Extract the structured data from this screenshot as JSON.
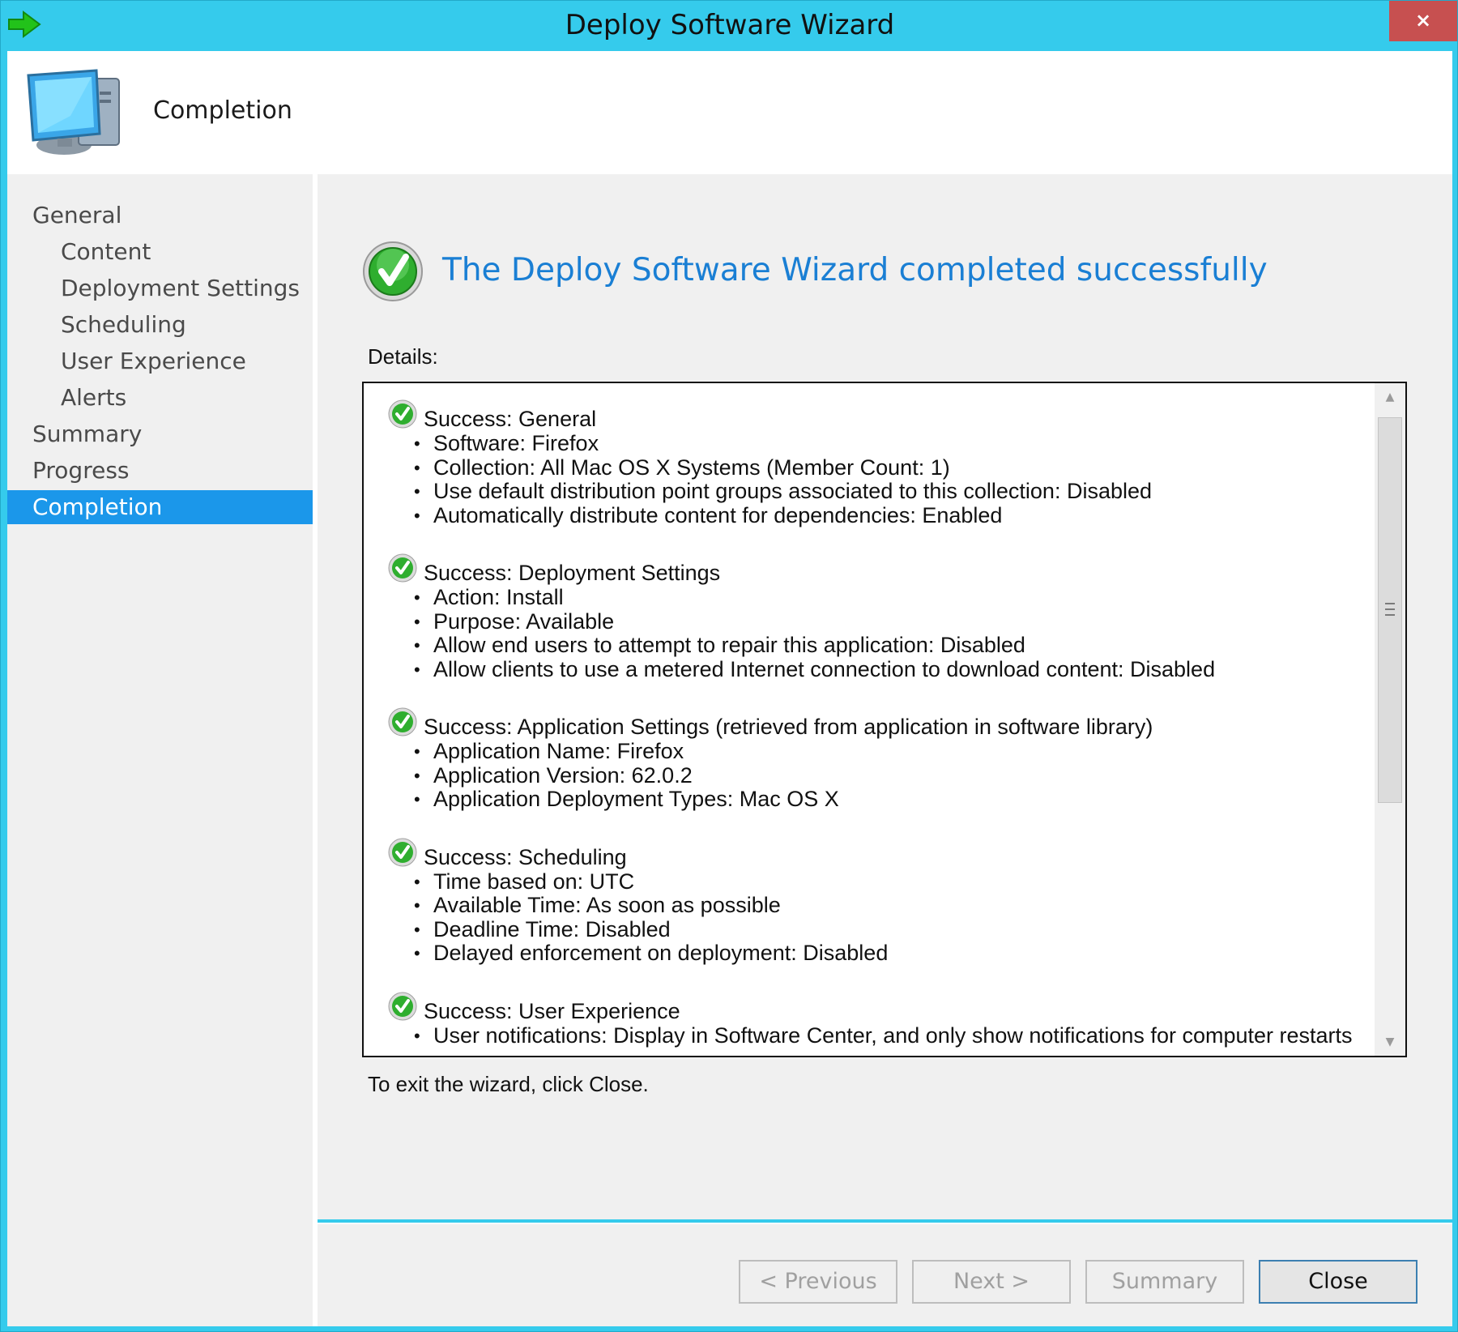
{
  "window": {
    "title": "Deploy Software Wizard",
    "close_glyph": "×",
    "app_icon": "green-arrow-icon"
  },
  "header": {
    "title": "Completion",
    "icon": "computer-icon"
  },
  "sidebar": {
    "items": [
      {
        "label": "General",
        "level": "top",
        "active": false
      },
      {
        "label": "Content",
        "level": "sub",
        "active": false
      },
      {
        "label": "Deployment Settings",
        "level": "sub",
        "active": false
      },
      {
        "label": "Scheduling",
        "level": "sub",
        "active": false
      },
      {
        "label": "User Experience",
        "level": "sub",
        "active": false
      },
      {
        "label": "Alerts",
        "level": "sub",
        "active": false
      },
      {
        "label": "Summary",
        "level": "top",
        "active": false
      },
      {
        "label": "Progress",
        "level": "top",
        "active": false
      },
      {
        "label": "Completion",
        "level": "top",
        "active": true
      }
    ]
  },
  "main": {
    "heading": "The Deploy Software Wizard completed successfully",
    "details_label": "Details:",
    "exit_text": "To exit the wizard, click Close.",
    "sections": [
      {
        "title": "Success: General",
        "items": [
          "Software: Firefox",
          "Collection: All Mac OS X Systems (Member Count: 1)",
          "Use default distribution point groups associated to this collection: Disabled",
          "Automatically distribute content for dependencies: Enabled"
        ]
      },
      {
        "title": "Success: Deployment Settings",
        "items": [
          "Action: Install",
          "Purpose: Available",
          "Allow end users to attempt to repair this application: Disabled",
          "Allow clients to use a metered Internet connection to download content: Disabled"
        ]
      },
      {
        "title": "Success: Application Settings (retrieved from application in software library)",
        "items": [
          "Application Name: Firefox",
          "Application Version: 62.0.2",
          "Application Deployment Types: Mac OS X"
        ]
      },
      {
        "title": "Success: Scheduling",
        "items": [
          "Time based on: UTC",
          "Available Time: As soon as possible",
          "Deadline Time: Disabled",
          "Delayed enforcement on deployment: Disabled"
        ]
      },
      {
        "title": "Success: User Experience",
        "items": [
          "User notifications: Display in Software Center, and only show notifications for computer restarts"
        ]
      }
    ]
  },
  "buttons": {
    "previous": "< Previous",
    "next": "Next >",
    "summary": "Summary",
    "close": "Close"
  },
  "colors": {
    "title_bar": "#35cbec",
    "active_nav": "#1b97ea",
    "heading_blue": "#1a7fd4",
    "close_red": "#c75050"
  }
}
